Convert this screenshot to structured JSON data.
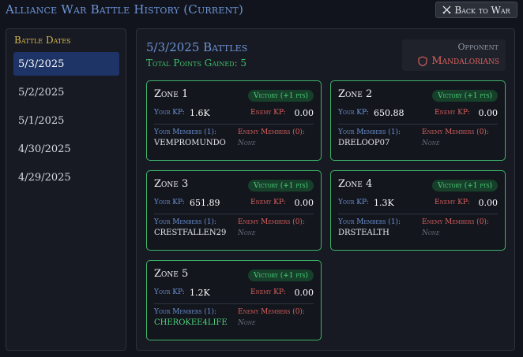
{
  "header": {
    "title": "Alliance War Battle History (Current)",
    "back_label": "Back to War"
  },
  "sidebar": {
    "title": "Battle Dates",
    "dates": [
      "5/3/2025",
      "5/2/2025",
      "5/1/2025",
      "4/30/2025",
      "4/29/2025"
    ],
    "selected": "5/3/2025"
  },
  "main": {
    "title": "5/3/2025 Battles",
    "points": "Total Points Gained: 5",
    "opponent_label": "Opponent",
    "opponent_name": "Mandalorians"
  },
  "labels": {
    "your_kp": "Your KP:",
    "enemy_kp": "Enemy KP:",
    "none": "None"
  },
  "zones": [
    {
      "title": "Zone 1",
      "result": "Victory (+1 pts)",
      "your_kp": "1.6K",
      "enemy_kp": "0.00",
      "your_members_label": "Your Members (1):",
      "enemy_members_label": "Enemy Members (0):",
      "member": "VEMPROMUNDO"
    },
    {
      "title": "Zone 2",
      "result": "Victory (+1 pts)",
      "your_kp": "650.88",
      "enemy_kp": "0.00",
      "your_members_label": "Your Members (1):",
      "enemy_members_label": "Enemy Members (0):",
      "member": "DRELOOP07"
    },
    {
      "title": "Zone 3",
      "result": "Victory (+1 pts)",
      "your_kp": "651.89",
      "enemy_kp": "0.00",
      "your_members_label": "Your Members (1):",
      "enemy_members_label": "Enemy Members (0):",
      "member": "CRESTFALLEN29"
    },
    {
      "title": "Zone 4",
      "result": "Victory (+1 pts)",
      "your_kp": "1.3K",
      "enemy_kp": "0.00",
      "your_members_label": "Your Members (1):",
      "enemy_members_label": "Enemy Members (0):",
      "member": "DRSTEALTH"
    },
    {
      "title": "Zone 5",
      "result": "Victory (+1 pts)",
      "your_kp": "1.2K",
      "enemy_kp": "0.00",
      "your_members_label": "Your Members (1):",
      "enemy_members_label": "Enemy Members (0):",
      "member": "CHEROKEE4LIFE"
    }
  ],
  "colors": {
    "accent_blue": "#6d93d6",
    "gold": "#d8b84a",
    "victory_green": "#3eb46a",
    "enemy_red": "#d8605e",
    "selected_bg": "#1e3366"
  },
  "icons": {
    "back": "crossed-swords-icon",
    "opponent": "shield-icon"
  }
}
